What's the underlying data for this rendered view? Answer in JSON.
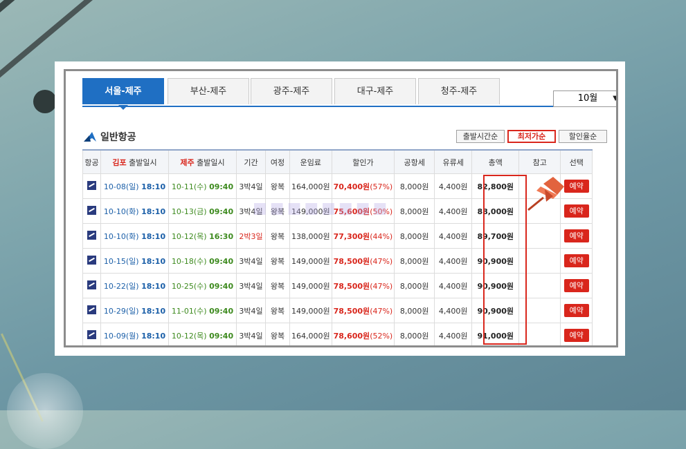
{
  "tabs": [
    {
      "label": "서울-제주",
      "active": true
    },
    {
      "label": "부산-제주",
      "active": false
    },
    {
      "label": "광주-제주",
      "active": false
    },
    {
      "label": "대구-제주",
      "active": false
    },
    {
      "label": "청주-제주",
      "active": false
    }
  ],
  "month_select": {
    "value": "10월"
  },
  "section": {
    "title": "일반항공"
  },
  "sort_buttons": [
    {
      "label": "출발시간순",
      "active": false
    },
    {
      "label": "최저가순",
      "active": true
    },
    {
      "label": "할인율순",
      "active": false
    }
  ],
  "table": {
    "headers": {
      "airline": "항공",
      "dep_origin": "김포",
      "dep_suffix": "출발일시",
      "ret_origin": "제주",
      "ret_suffix": "출발일시",
      "period": "기간",
      "trip": "여정",
      "fare": "운임료",
      "discount": "할인가",
      "airport_tax": "공항세",
      "fuel_tax": "유류세",
      "total": "총액",
      "note": "참고",
      "select": "선택"
    },
    "rows": [
      {
        "dep_date": "10-08(일)",
        "dep_time": "18:10",
        "ret_date": "10-11(수)",
        "ret_time": "09:40",
        "period": "3박4일",
        "trip": "왕복",
        "fare": "164,000원",
        "discount": "70,400원",
        "rate": "(57%)",
        "airport_tax": "8,000원",
        "fuel_tax": "4,400원",
        "total": "82,800원",
        "reserve": "예약"
      },
      {
        "dep_date": "10-10(화)",
        "dep_time": "18:10",
        "ret_date": "10-13(금)",
        "ret_time": "09:40",
        "period": "3박4일",
        "trip": "왕복",
        "fare": "149,000원",
        "discount": "75,600원",
        "rate": "(50%)",
        "airport_tax": "8,000원",
        "fuel_tax": "4,400원",
        "total": "88,000원",
        "reserve": "예약"
      },
      {
        "dep_date": "10-10(화)",
        "dep_time": "18:10",
        "ret_date": "10-12(목)",
        "ret_time": "16:30",
        "period": "2박3일",
        "trip": "왕복",
        "fare": "138,000원",
        "discount": "77,300원",
        "rate": "(44%)",
        "airport_tax": "8,000원",
        "fuel_tax": "4,400원",
        "total": "89,700원",
        "reserve": "예약"
      },
      {
        "dep_date": "10-15(일)",
        "dep_time": "18:10",
        "ret_date": "10-18(수)",
        "ret_time": "09:40",
        "period": "3박4일",
        "trip": "왕복",
        "fare": "149,000원",
        "discount": "78,500원",
        "rate": "(47%)",
        "airport_tax": "8,000원",
        "fuel_tax": "4,400원",
        "total": "90,900원",
        "reserve": "예약"
      },
      {
        "dep_date": "10-22(일)",
        "dep_time": "18:10",
        "ret_date": "10-25(수)",
        "ret_time": "09:40",
        "period": "3박4일",
        "trip": "왕복",
        "fare": "149,000원",
        "discount": "78,500원",
        "rate": "(47%)",
        "airport_tax": "8,000원",
        "fuel_tax": "4,400원",
        "total": "90,900원",
        "reserve": "예약"
      },
      {
        "dep_date": "10-29(일)",
        "dep_time": "18:10",
        "ret_date": "11-01(수)",
        "ret_time": "09:40",
        "period": "3박4일",
        "trip": "왕복",
        "fare": "149,000원",
        "discount": "78,500원",
        "rate": "(47%)",
        "airport_tax": "8,000원",
        "fuel_tax": "4,400원",
        "total": "90,900원",
        "reserve": "예약"
      },
      {
        "dep_date": "10-09(월)",
        "dep_time": "18:10",
        "ret_date": "10-12(목)",
        "ret_time": "09:40",
        "period": "3박4일",
        "trip": "왕복",
        "fare": "164,000원",
        "discount": "78,600원",
        "rate": "(52%)",
        "airport_tax": "8,000원",
        "fuel_tax": "4,400원",
        "total": "91,000원",
        "reserve": "예약"
      }
    ]
  },
  "colors": {
    "accent_blue": "#1f6fc3",
    "highlight_red": "#d9261c",
    "departure_text": "#1b5fa8",
    "return_text": "#3d8a1e"
  }
}
